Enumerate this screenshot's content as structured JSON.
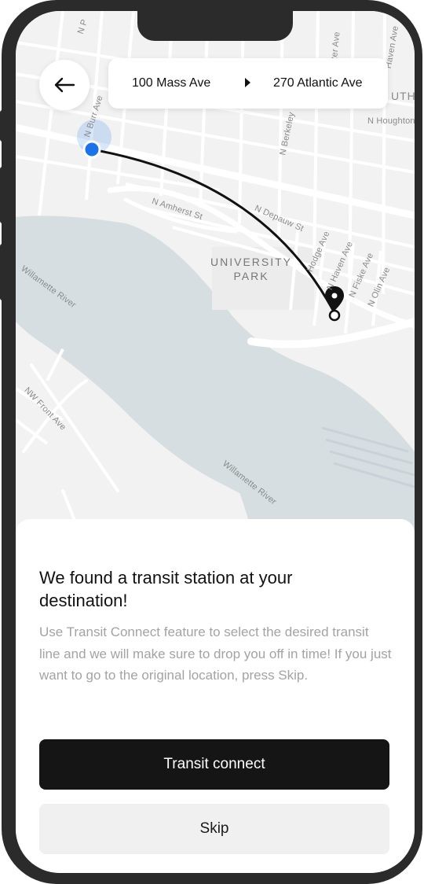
{
  "route": {
    "from": "100 Mass Ave",
    "to": "270 Atlantic Ave"
  },
  "map": {
    "park_label_line1": "UNIVERSITY",
    "park_label_line2": "PARK",
    "streets": {
      "n_amherst": "N Amherst St",
      "n_depauw": "N Depauw St",
      "n_burr": "N Burr Ave",
      "n_berkeley": "N Berkeley",
      "n_houghton": "N Houghton",
      "hodge": "Hodge Ave",
      "n_haven": "N Haven Ave",
      "n_fiske": "N Fiske Ave",
      "n_olin": "N Olin Ave",
      "nw_front": "NW Front Ave",
      "willamette_upper": "Willamette River",
      "willamette_lower": "Willamette River",
      "haven_top": "Haven Ave",
      "ter_ave": "ter Ave",
      "uth": "UTH",
      "n_p": "N P"
    },
    "colors": {
      "land": "#f2f2f2",
      "water": "#d6dee2",
      "road": "#ffffff",
      "origin": "#1a73e8",
      "route_line": "#111111"
    }
  },
  "sheet": {
    "title": "We found a transit station at your destination!",
    "body": "Use Transit Connect feature to select the desired transit line and we will make sure to drop you off in time! If you just want to go to the original location, press Skip.",
    "primary_label": "Transit connect",
    "secondary_label": "Skip"
  },
  "icons": {
    "back": "arrow-left-icon",
    "route_separator": "play-arrow-icon",
    "destination": "map-pin-icon"
  }
}
